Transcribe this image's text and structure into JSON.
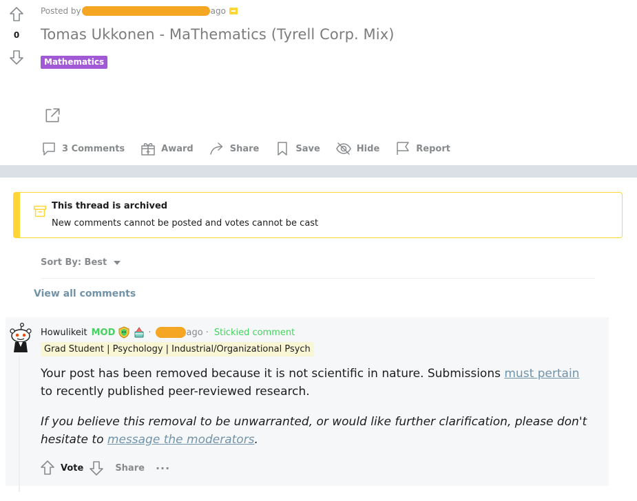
{
  "post": {
    "score": "0",
    "posted_by_prefix": "Posted by",
    "posted_ago": "ago",
    "title": "Tomas Ukkonen - MaThematics (Tyrell Corp. Mix)",
    "flair": "Mathematics",
    "flair_color": "#a259d6",
    "actions": {
      "comments": "3 Comments",
      "award": "Award",
      "share": "Share",
      "save": "Save",
      "hide": "Hide",
      "report": "Report"
    }
  },
  "archived": {
    "title": "This thread is archived",
    "message": "New comments cannot be posted and votes cannot be cast",
    "accent": "#ffd635"
  },
  "sort": {
    "label": "Sort By: Best"
  },
  "view_all": "View all comments",
  "comment": {
    "author": "Howulikeit",
    "mod_badge": "MOD",
    "separator": "·",
    "ago": "ago",
    "stickied": "Stickied comment",
    "user_flair": "Grad Student | Psychology | Industrial/Organizational Psych",
    "body1_prefix": "Your post has been removed because it is not scientific in nature. Submissions ",
    "body1_link": "must pertain",
    "body1_suffix": " to recently published peer-reviewed research.",
    "body2_prefix": "If you believe this removal to be unwarranted, or would like further clarification, please don't hesitate to ",
    "body2_link": "message the moderators",
    "body2_suffix": ".",
    "vote_label": "Vote",
    "share_label": "Share",
    "more_label": "···"
  },
  "colors": {
    "band": "#dae0e6",
    "muted": "#878a8c",
    "link": "#7193a9",
    "mod_green": "#46d160",
    "redaction": "#f5a623"
  }
}
